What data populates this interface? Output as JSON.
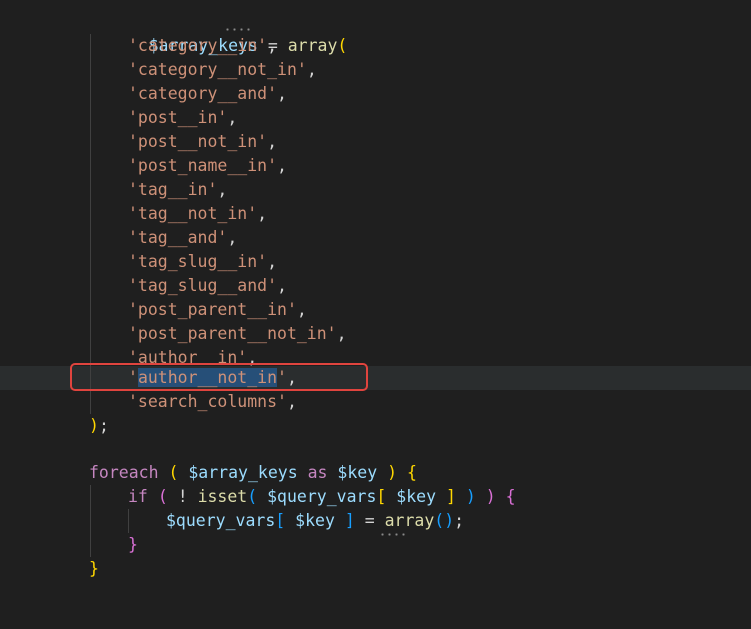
{
  "code": {
    "array_decl": {
      "var": "$array_keys",
      "assign": " = ",
      "fn": "array",
      "open": "("
    },
    "array_items": [
      "'category__in'",
      "'category__not_in'",
      "'category__and'",
      "'post__in'",
      "'post__not_in'",
      "'post_name__in'",
      "'tag__in'",
      "'tag__not_in'",
      "'tag__and'",
      "'tag_slug__in'",
      "'tag_slug__and'",
      "'post_parent__in'",
      "'post_parent__not_in'",
      "'author__in'",
      "'author__not_in'",
      "'search_columns'"
    ],
    "comma": ",",
    "close_paren": ")",
    "semicolon": ";",
    "foreach_line": {
      "kw": "foreach",
      "paren_open": "(",
      "var": "$array_keys",
      "as": "as",
      "key": "$key",
      "paren_close": ")",
      "brace": "{"
    },
    "if_line": {
      "kw": "if",
      "paren_open": "(",
      "not": "!",
      "fn": "isset",
      "fn_open": "(",
      "var": "$query_vars",
      "bracket_open": "[",
      "key": "$key",
      "bracket_close": "]",
      "fn_close": ")",
      "paren_close": ")",
      "brace": "{"
    },
    "assign_line": {
      "var": "$query_vars",
      "bracket_open": "[",
      "key": "$key",
      "bracket_close": "]",
      "eq": "=",
      "fn": "array",
      "call": "()",
      "semi": ";"
    },
    "inner_close": "}",
    "outer_close": "}",
    "selected_text": "author__not_in"
  }
}
